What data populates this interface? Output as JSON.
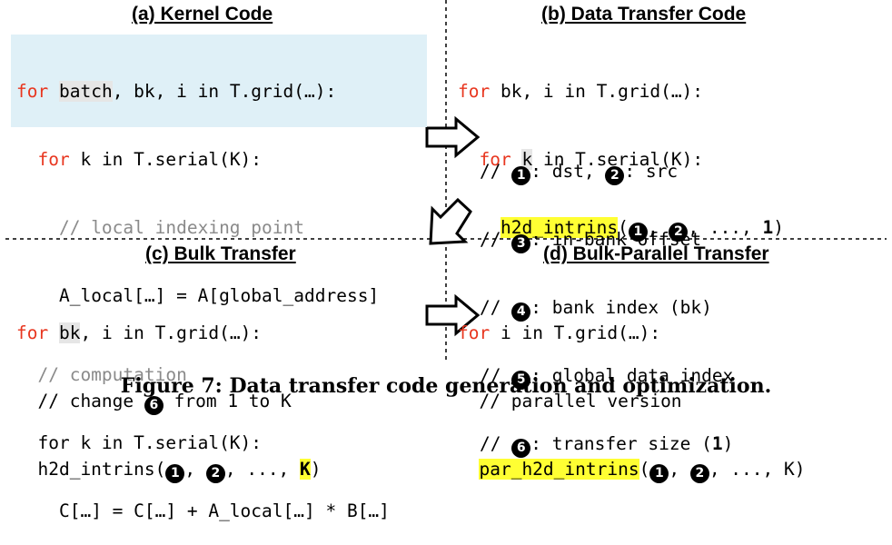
{
  "panels": {
    "a_title": "(a) Kernel Code",
    "b_title": "(b) Data Transfer Code",
    "c_title": "(c) Bulk Transfer",
    "d_title": "(d) Bulk-Parallel Transfer"
  },
  "kernel": {
    "l1_kw": "for",
    "l1_hl": "batch",
    "l1_rest": ", bk, i in T.grid(…):",
    "l2_kw": "for",
    "l2_rest": " k in T.serial(K):",
    "l3_cm": "// local indexing point",
    "l4": "A_local[…] = A[global_address]",
    "l5_cm": "// computation",
    "l6": "for k in T.serial(K):",
    "l7": "C[…] = C[…] + A_local[…] * B[…]"
  },
  "transfer": {
    "l1_kw": "for",
    "l1_rest": " bk, i in T.grid(…):",
    "l2_kw": "for",
    "l2_hl": "k",
    "l2_rest": " in T.serial(K):",
    "l3_fn": "h2d_intrins",
    "l3_open": "(",
    "l3_sep1": ", ",
    "l3_sep2": ", ..., ",
    "l3_last": "1",
    "l3_close": ")",
    "legend_prefix": "//",
    "legend1a": ": dst, ",
    "legend1b": ": src",
    "legend3": ": in-bank offset",
    "legend4": ": bank index (bk)",
    "legend5": ": global data index",
    "legend6a": ": transfer size (",
    "legend6b": "1",
    "legend6c": ")"
  },
  "bulk": {
    "l1_kw": "for",
    "l1_hl": "bk",
    "l1_rest": ", i in T.grid(…):",
    "l2a": "// change ",
    "l2b": " from 1 to K",
    "l3_fn": "h2d_intrins(",
    "l3_sep1": ", ",
    "l3_sep2": ", ..., ",
    "l3_hl": "K",
    "l3_close": ")"
  },
  "parallel": {
    "l1_kw": "for",
    "l1_rest": " i in T.grid(…):",
    "l2": "// parallel version",
    "l3_fn": "par_h2d_intrins",
    "l3_open": "(",
    "l3_sep1": ", ",
    "l3_sep2": ", ..., K)"
  },
  "circles": {
    "n1": "1",
    "n2": "2",
    "n3": "3",
    "n4": "4",
    "n5": "5",
    "n6": "6"
  },
  "caption": "Figure 7: Data transfer code generation and optimization."
}
